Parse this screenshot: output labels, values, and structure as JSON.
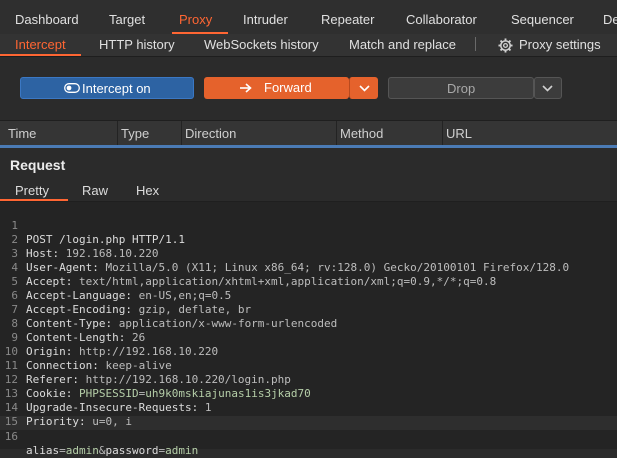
{
  "main_tabs": [
    "Dashboard",
    "Target",
    "Proxy",
    "Intruder",
    "Repeater",
    "Collaborator",
    "Sequencer",
    "De"
  ],
  "sub_tabs": [
    "Intercept",
    "HTTP history",
    "WebSockets history",
    "Match and replace"
  ],
  "proxy_settings": "Proxy settings",
  "toolbar": {
    "intercept_label": "Intercept on",
    "forward_label": "Forward",
    "drop_label": "Drop"
  },
  "columns": [
    "Time",
    "Type",
    "Direction",
    "Method",
    "URL"
  ],
  "request": {
    "title": "Request",
    "view_tabs": [
      "Pretty",
      "Raw",
      "Hex"
    ],
    "lines": [
      {
        "n": "1",
        "text": "POST /login.php HTTP/1.1"
      },
      {
        "n": "2",
        "name": "Host",
        "value": "192.168.10.220"
      },
      {
        "n": "3",
        "name": "User-Agent",
        "value": "Mozilla/5.0 (X11; Linux x86_64; rv:128.0) Gecko/20100101 Firefox/128.0"
      },
      {
        "n": "4",
        "name": "Accept",
        "value": "text/html,application/xhtml+xml,application/xml;q=0.9,*/*;q=0.8"
      },
      {
        "n": "5",
        "name": "Accept-Language",
        "value": "en-US,en;q=0.5"
      },
      {
        "n": "6",
        "name": "Accept-Encoding",
        "value": "gzip, deflate, br"
      },
      {
        "n": "7",
        "name": "Content-Type",
        "value": "application/x-www-form-urlencoded"
      },
      {
        "n": "8",
        "name": "Content-Length",
        "value": "26"
      },
      {
        "n": "9",
        "name": "Origin",
        "value": "http://192.168.10.220"
      },
      {
        "n": "10",
        "name": "Connection",
        "value": "keep-alive"
      },
      {
        "n": "11",
        "name": "Referer",
        "value": "http://192.168.10.220/login.php"
      },
      {
        "n": "12",
        "name": "Cookie",
        "cookie_name": "PHPSESSID",
        "cookie_value": "uh9k0mskiajunas1is3jkad70"
      },
      {
        "n": "13",
        "name": "Upgrade-Insecure-Requests",
        "value": "1"
      },
      {
        "n": "14",
        "name": "Priority",
        "value": "u=0, i"
      },
      {
        "n": "15",
        "text": ""
      },
      {
        "n": "16",
        "body": {
          "k1": "alias",
          "v1": "admin",
          "k2": "password",
          "v2": "admin"
        }
      }
    ]
  },
  "colors": {
    "accent": "#ff6633",
    "intercept_blue": "#2d63a3",
    "forward_orange": "#e5622c",
    "param_green": "#b5cea8"
  }
}
